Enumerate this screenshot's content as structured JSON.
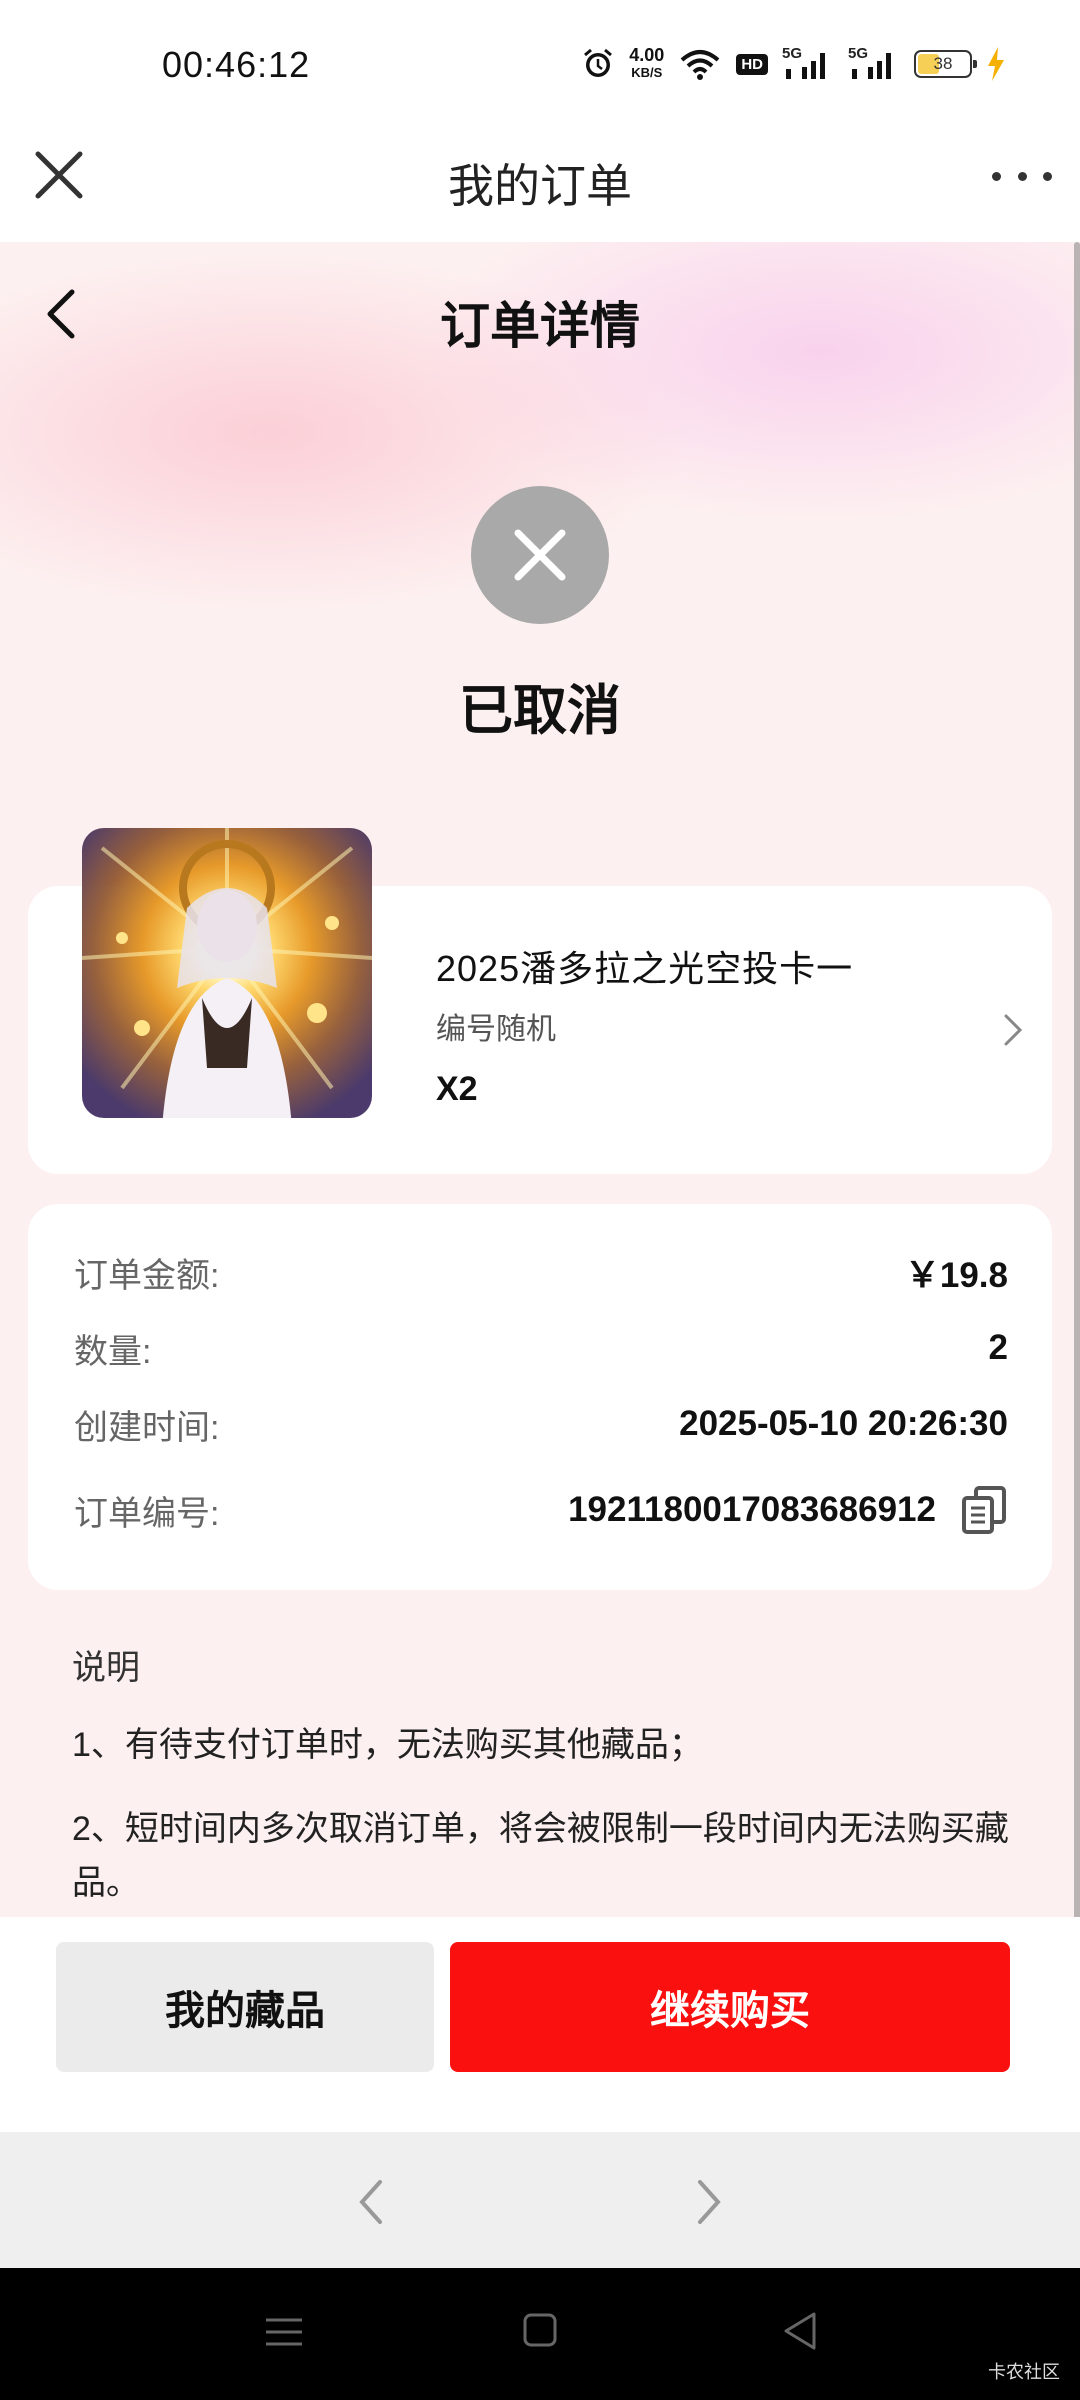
{
  "status_bar": {
    "time": "00:46:12",
    "net_speed": "4.00",
    "net_speed_unit": "KB/S",
    "hd_badge": "HD",
    "signal_1": "5G",
    "signal_2": "5G",
    "battery": "38"
  },
  "header": {
    "title": "我的订单"
  },
  "page": {
    "title": "订单详情",
    "status": "已取消"
  },
  "product": {
    "name": "2025潘多拉之光空投卡一",
    "subtitle": "编号随机",
    "quantity": "X2"
  },
  "order_info": {
    "rows": [
      {
        "label": "订单金额:",
        "value": "￥19.8"
      },
      {
        "label": "数量:",
        "value": "2"
      },
      {
        "label": "创建时间:",
        "value": "2025-05-10 20:26:30"
      },
      {
        "label": "订单编号:",
        "value": "1921180017083686912"
      }
    ]
  },
  "notes": {
    "title": "说明",
    "lines": [
      "1、有待支付订单时，无法购买其他藏品；",
      "2、短时间内多次取消订单，将会被限制一段时间内无法购买藏品。"
    ]
  },
  "actions": {
    "secondary": "我的藏品",
    "primary": "继续购买"
  },
  "watermark": "卡农社区",
  "colors": {
    "primary_button": "#fb1010",
    "cancel_circle": "#a9a9a9",
    "page_bg": "#fdf0f0"
  }
}
